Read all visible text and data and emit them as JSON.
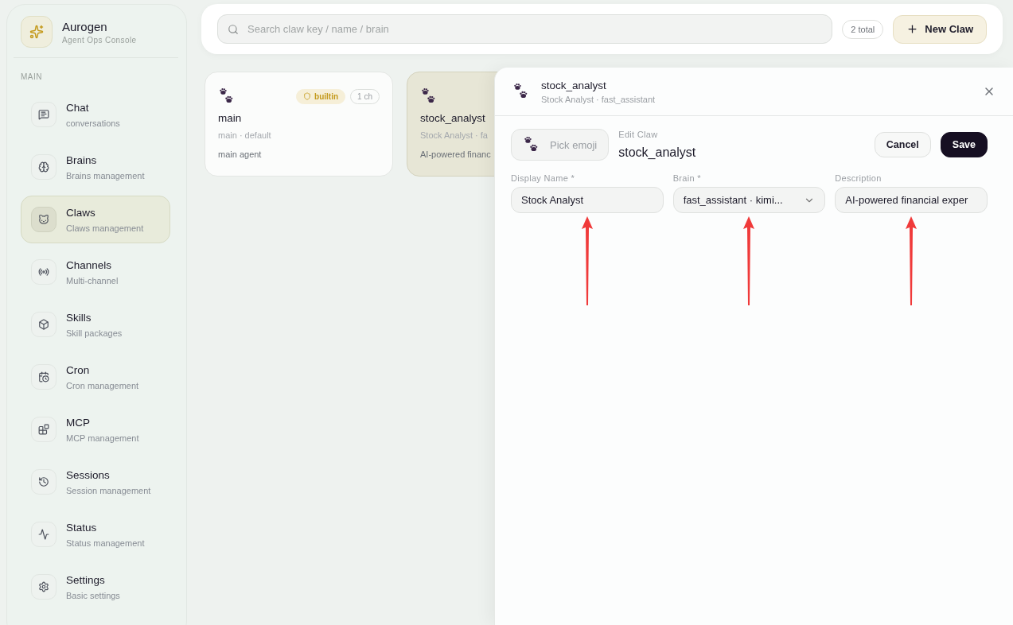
{
  "brand": {
    "name": "Aurogen",
    "tagline": "Agent Ops Console"
  },
  "sidebar": {
    "section": "MAIN",
    "items": [
      {
        "label": "Chat",
        "sub": "conversations",
        "selected": false
      },
      {
        "label": "Brains",
        "sub": "Brains management",
        "selected": false
      },
      {
        "label": "Claws",
        "sub": "Claws management",
        "selected": true
      },
      {
        "label": "Channels",
        "sub": "Multi-channel",
        "selected": false
      },
      {
        "label": "Skills",
        "sub": "Skill packages",
        "selected": false
      },
      {
        "label": "Cron",
        "sub": "Cron management",
        "selected": false
      },
      {
        "label": "MCP",
        "sub": "MCP management",
        "selected": false
      },
      {
        "label": "Sessions",
        "sub": "Session management",
        "selected": false
      },
      {
        "label": "Status",
        "sub": "Status management",
        "selected": false
      },
      {
        "label": "Settings",
        "sub": "Basic settings",
        "selected": false
      }
    ]
  },
  "toolbar": {
    "search_placeholder": "Search claw key / name / brain",
    "count": "2 total",
    "new_button": "New Claw"
  },
  "cards": [
    {
      "title": "main",
      "meta": "main · default",
      "description": "main agent",
      "badges": [
        "builtin",
        "1 ch"
      ],
      "selected": false
    },
    {
      "title": "stock_analyst",
      "meta": "Stock Analyst · fa",
      "description": "AI-powered financ",
      "selected": true
    }
  ],
  "drawer": {
    "title": "stock_analyst",
    "subtitle": "Stock Analyst · fast_assistant",
    "emoji_button": "Pick emoji",
    "form_label": "Edit Claw",
    "form_title": "stock_analyst",
    "cancel": "Cancel",
    "save": "Save",
    "fields": [
      {
        "label": "Display Name *",
        "value": "Stock Analyst",
        "kind": "text",
        "marked": true
      },
      {
        "label": "Brain *",
        "value": "fast_assistant · kimi...",
        "kind": "select",
        "marked": true
      },
      {
        "label": "Description",
        "value": "AI-powered financial exper",
        "kind": "text",
        "marked": true
      }
    ]
  }
}
